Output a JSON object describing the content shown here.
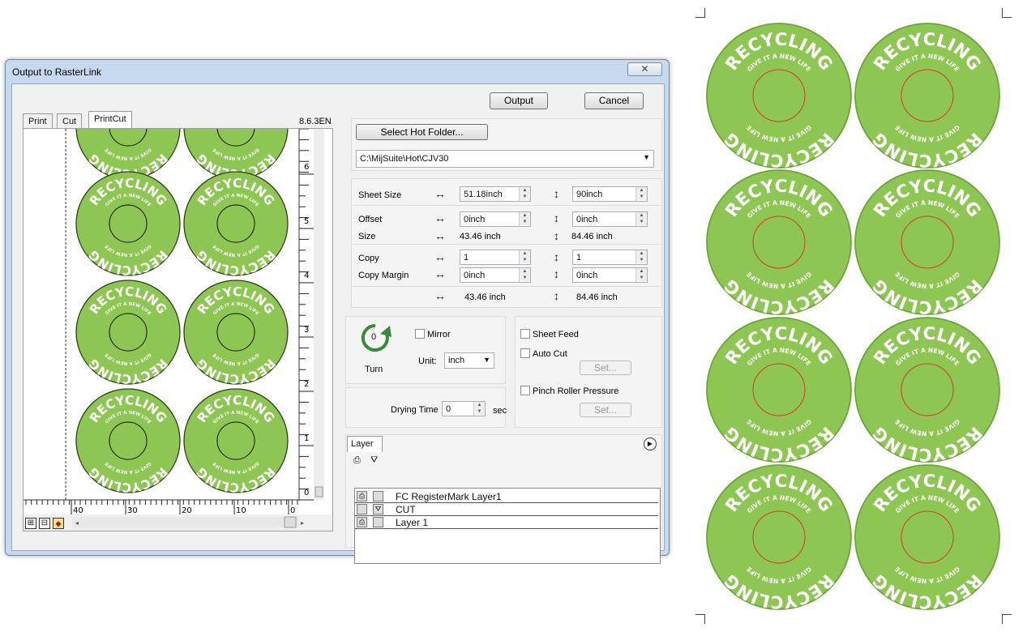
{
  "window": {
    "title": "Output to RasterLink",
    "close_glyph": "✕"
  },
  "buttons": {
    "output": "Output",
    "cancel": "Cancel",
    "select_hot_folder": "Select Hot Folder...",
    "set1": "Set...",
    "set2": "Set..."
  },
  "tabs": [
    "Print",
    "Cut",
    "PrintCut"
  ],
  "active_tab": "PrintCut",
  "version": "8.6.3EN",
  "hot_folder": {
    "path": "C:\\MijSuite\\Hot\\CJV30"
  },
  "sheet": {
    "sheet_size_label": "Sheet Size",
    "sheet_width": "51.18inch",
    "sheet_height": "90inch",
    "offset_label": "Offset",
    "offset_x": "0inch",
    "offset_y": "0inch",
    "size_label": "Size",
    "size_w": "43.46 inch",
    "size_h": "84.46 inch",
    "copy_label": "Copy",
    "copy_x": "1",
    "copy_y": "1",
    "copy_margin_label": "Copy Margin",
    "margin_x": "0inch",
    "margin_y": "0inch",
    "total_w": "43.46 inch",
    "total_h": "84.46 inch"
  },
  "orientation": {
    "turn_label": "Turn",
    "turn_value": "0",
    "mirror_label": "Mirror",
    "unit_label": "Unit:",
    "unit_value": "inch"
  },
  "options": {
    "sheet_feed": "Sheet Feed",
    "auto_cut": "Auto Cut",
    "pinch_roller": "Pinch Roller Pressure"
  },
  "drying": {
    "label": "Drying Time",
    "value": "0",
    "unit": "sec"
  },
  "layer_panel": {
    "tab": "Layer",
    "layers": [
      {
        "name": "FC RegisterMark Layer1",
        "print": true,
        "cut": false
      },
      {
        "name": "CUT",
        "print": false,
        "cut": true
      },
      {
        "name": "Layer 1",
        "print": true,
        "cut": false
      }
    ]
  },
  "ruler": {
    "vertical_ticks": [
      "6",
      "5",
      "4",
      "3",
      "2",
      "1",
      "0"
    ],
    "horizontal_ticks": [
      "40",
      "30",
      "20",
      "10",
      "0"
    ]
  },
  "label_design": {
    "top_text": "RECYCLING",
    "sub_text": "GIVE IT A NEW LIFE",
    "fill_color": "#8dc653",
    "edge_color": "#6ea33c"
  },
  "colors": {
    "accent_green": "#3a8a3a",
    "window_frame": "#c6d9ee"
  }
}
